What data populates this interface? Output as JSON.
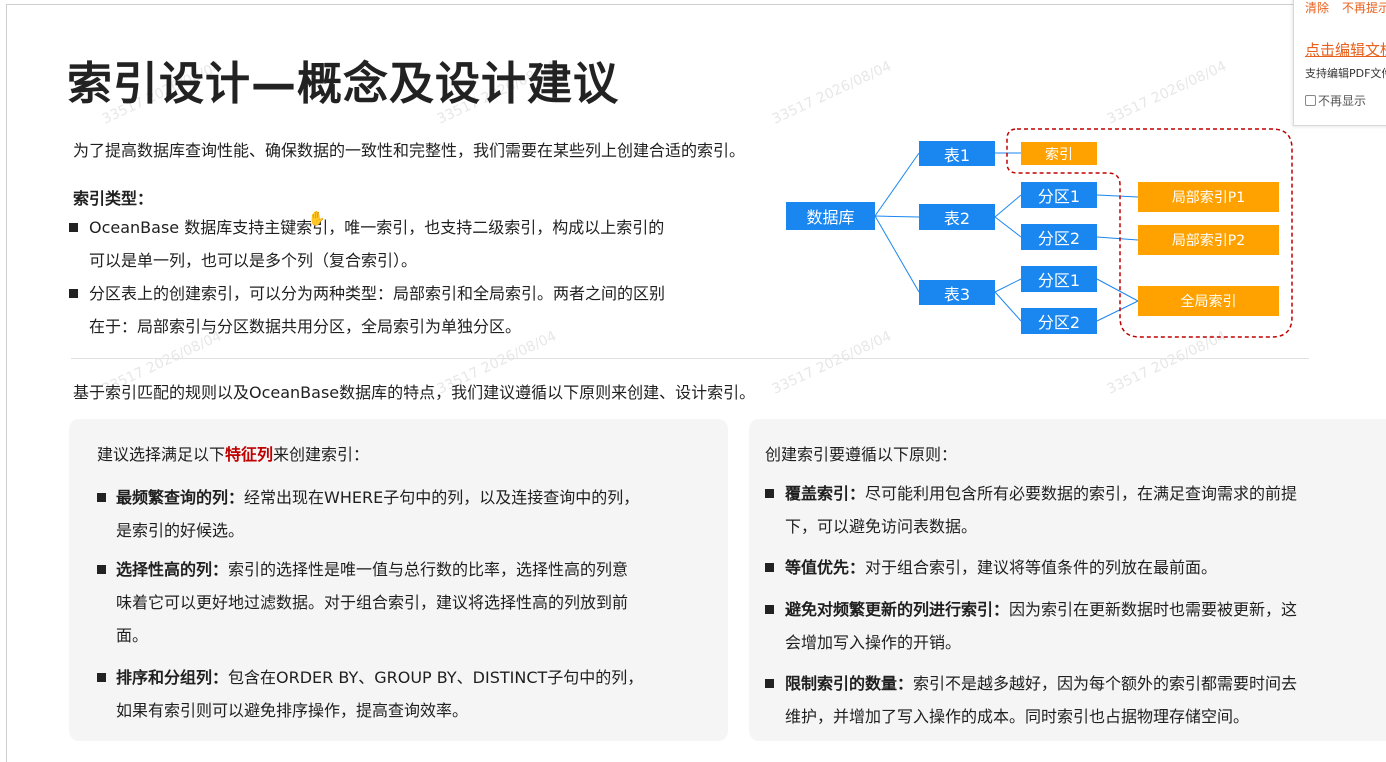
{
  "slide": {
    "title": "索引设计—概念及设计建议",
    "intro": "为了提高数据库查询性能、确保数据的一致性和完整性，我们需要在某些列上创建合适的索引。",
    "types_heading": "索引类型：",
    "types": [
      {
        "line1": "OceanBase 数据库支持主键索引，唯一索引，也支持二级索引，构成以上索引的",
        "line2": "可以是单一列，也可以是多个列（复合索引）。"
      },
      {
        "line1": "分区表上的创建索引，可以分为两种类型：局部索引和全局索引。两者之间的区别",
        "line2": "在于：局部索引与分区数据共用分区，全局索引为单独分区。"
      }
    ],
    "principle": "基于索引匹配的规则以及OceanBase数据库的特点，我们建议遵循以下原则来创建、设计索引。",
    "watermark": "33517 2026/08/04"
  },
  "diagram": {
    "database": "数据库",
    "table1": "表1",
    "table2": "表2",
    "table3": "表3",
    "index": "索引",
    "t2_part1": "分区1",
    "t2_part2": "分区2",
    "t3_part1": "分区1",
    "t3_part2": "分区2",
    "local_p1": "局部索引P1",
    "local_p2": "局部索引P2",
    "global": "全局索引",
    "colors": {
      "blue": "#1a86f0",
      "orange": "#ffa200",
      "dash": "#c00000"
    }
  },
  "left_card": {
    "head_pre": "建议选择满足以下",
    "head_hl": "特征列",
    "head_post": "来创建索引：",
    "items": [
      {
        "bold": "最频繁查询的列：",
        "text": "经常出现在WHERE子句中的列，以及连接查询中的列，",
        "line2": "是索引的好候选。"
      },
      {
        "bold": "选择性高的列：",
        "text": "索引的选择性是唯一值与总行数的比率，选择性高的列意",
        "line2": "味着它可以更好地过滤数据。对于组合索引，建议将选择性高的列放到前",
        "line3": "面。"
      },
      {
        "bold": "排序和分组列：",
        "text": "包含在ORDER BY、GROUP BY、DISTINCT子句中的列，",
        "line2": "如果有索引则可以避免排序操作，提高查询效率。"
      }
    ]
  },
  "right_card": {
    "head": "创建索引要遵循以下原则：",
    "items": [
      {
        "bold": "覆盖索引：",
        "text": "尽可能利用包含所有必要数据的索引，在满足查询需求的前提",
        "line2": "下，可以避免访问表数据。"
      },
      {
        "bold": "等值优先：",
        "text": "对于组合索引，建议将等值条件的列放在最前面。"
      },
      {
        "bold": "避免对频繁更新的列进行索引：",
        "text": "因为索引在更新数据时也需要被更新，这",
        "line2": "会增加写入操作的开销。"
      },
      {
        "bold": "限制索引的数量：",
        "text": "索引不是越多越好，因为每个额外的索引都需要时间去",
        "line2": "维护，并增加了写入操作的成本。同时索引也占据物理存储空间。"
      }
    ]
  },
  "popup": {
    "clear": "清除",
    "no_more_prompt": "不再提示",
    "edit": "点击编辑文档",
    "support": "支持编辑PDF文件",
    "no_show": "不再显示"
  }
}
